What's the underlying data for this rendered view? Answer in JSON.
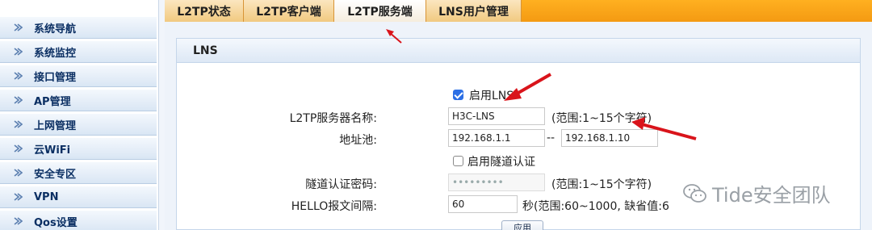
{
  "sidebar": {
    "items": [
      {
        "label": "系统导航"
      },
      {
        "label": "系统监控"
      },
      {
        "label": "接口管理"
      },
      {
        "label": "AP管理"
      },
      {
        "label": "上网管理"
      },
      {
        "label": "云WiFi"
      },
      {
        "label": "安全专区"
      },
      {
        "label": "VPN"
      },
      {
        "label": "Qos设置"
      }
    ]
  },
  "tabs": [
    {
      "label": "L2TP状态"
    },
    {
      "label": "L2TP客户端"
    },
    {
      "label": "L2TP服务端",
      "active": true
    },
    {
      "label": "LNS用户管理"
    }
  ],
  "panel": {
    "title": "LNS",
    "enable_lns": {
      "label": "启用LNS",
      "checked": true
    },
    "server_name": {
      "label": "L2TP服务器名称:",
      "value": "H3C-LNS",
      "hint": "(范围:1~15个字符)"
    },
    "address_pool": {
      "label": "地址池:",
      "start": "192.168.1.1",
      "separator": "--",
      "end": "192.168.1.10"
    },
    "tunnel_auth": {
      "label": "启用隧道认证",
      "checked": false
    },
    "tunnel_password": {
      "label": "隧道认证密码:",
      "value": "•••••••••",
      "hint": "(范围:1~15个字符)"
    },
    "hello_interval": {
      "label": "HELLO报文间隔:",
      "value": "60",
      "hint": "秒(范围:60~1000, 缺省值:6"
    },
    "apply_label": "应用"
  },
  "watermark": {
    "text": "Tide安全团队"
  },
  "colors": {
    "accent_orange": "#f49a12",
    "annotation_red": "#d9141b",
    "checkbox_blue": "#2c6fe5"
  }
}
